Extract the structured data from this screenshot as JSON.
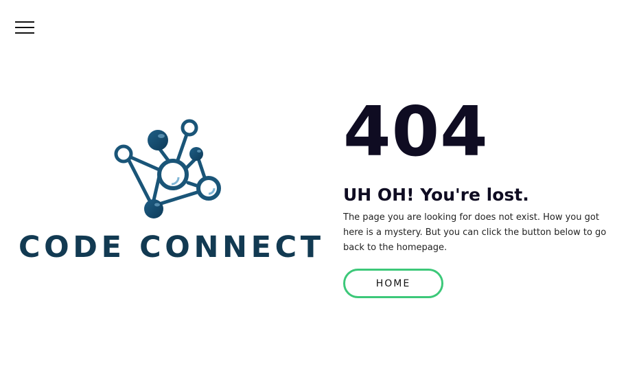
{
  "nav": {
    "menu_icon": "hamburger-menu-icon"
  },
  "logo": {
    "icon": "network-nodes-icon",
    "text": "CODE CONNECT",
    "color": "#123a52"
  },
  "error": {
    "code": "404",
    "headline": "UH OH! You're lost.",
    "description": "The page you are looking for does not exist. How you got here is a mystery. But you can click the button below to go back to the homepage.",
    "home_button_label": "HOME"
  },
  "colors": {
    "accent": "#3cc879",
    "text_dark": "#0f0c22",
    "logo_blue": "#123a52"
  }
}
